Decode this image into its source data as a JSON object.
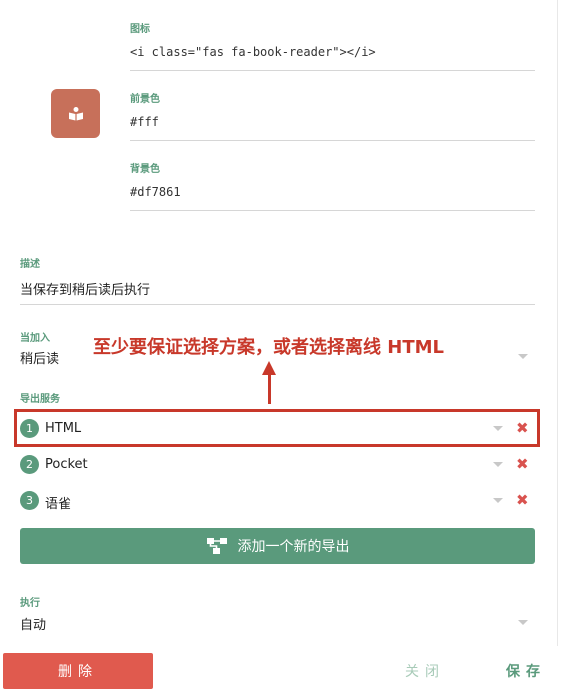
{
  "icon_field": {
    "label": "图标",
    "value": "<i class=\"fas fa-book-reader\"></i>"
  },
  "foreground_field": {
    "label": "前景色",
    "value": "#fff"
  },
  "background_field": {
    "label": "背景色",
    "value": "#df7861"
  },
  "description_field": {
    "label": "描述",
    "value": "当保存到稍后读后执行"
  },
  "trigger_field": {
    "label": "当加入",
    "value": "稍后读"
  },
  "export_services": {
    "label": "导出服务",
    "items": [
      {
        "number": "1",
        "name": "HTML"
      },
      {
        "number": "2",
        "name": "Pocket"
      },
      {
        "number": "3",
        "name": "语雀"
      }
    ],
    "add_label": "添加一个新的导出"
  },
  "execute_field": {
    "label": "执行",
    "value": "自动"
  },
  "annotation": {
    "text": "至少要保证选择方案，或者选择离线 HTML"
  },
  "footer": {
    "delete_label": "删除",
    "close_label": "关闭",
    "save_label": "保存"
  },
  "colors": {
    "accent": "#5a9a7c",
    "icon_bg": "#c7705a",
    "danger": "#e05a4e",
    "annotation": "#c8382a"
  },
  "icons": {
    "preview": "book-reader-icon",
    "add": "sitemap-icon",
    "remove": "close-icon",
    "dropdown": "caret-down-icon"
  }
}
